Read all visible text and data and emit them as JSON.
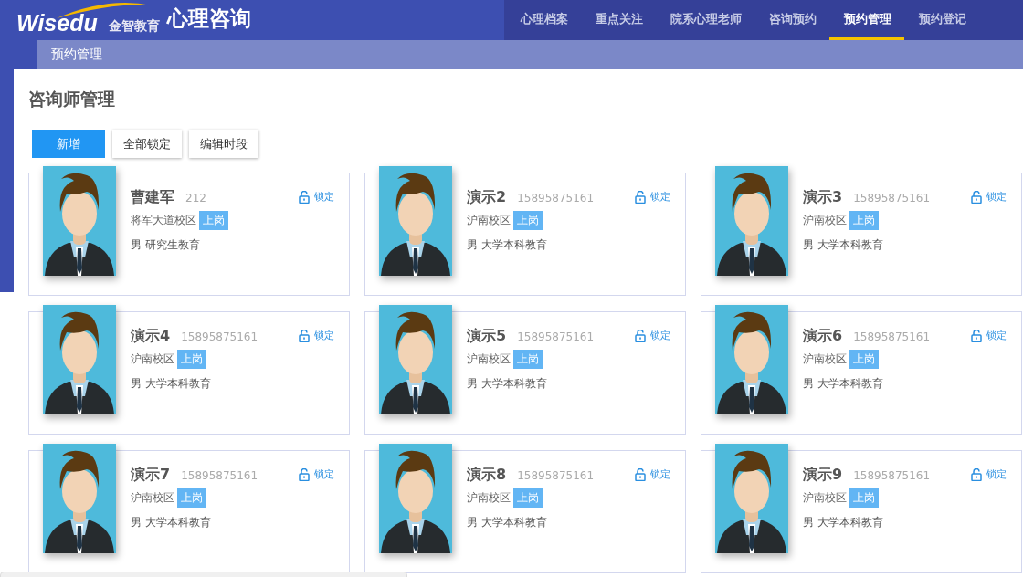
{
  "header": {
    "logo_text": "Wisedu",
    "logo_subtext": "金智教育",
    "app_title": "心理咨询"
  },
  "nav_tabs": [
    {
      "label": "心理档案",
      "selected": false
    },
    {
      "label": "重点关注",
      "selected": false
    },
    {
      "label": "院系心理老师",
      "selected": false
    },
    {
      "label": "咨询预约",
      "selected": false
    },
    {
      "label": "预约管理",
      "selected": true
    },
    {
      "label": "预约登记",
      "selected": false
    }
  ],
  "breadcrumb": "预约管理",
  "page_title": "咨询师管理",
  "toolbar": [
    {
      "label": "新增",
      "kind": "primary"
    },
    {
      "label": "全部锁定",
      "kind": "default"
    },
    {
      "label": "编辑时段",
      "kind": "default"
    }
  ],
  "counselors": [
    {
      "name": "曹建军",
      "phone": "212",
      "campus": "将军大道校区",
      "status": "上岗",
      "details": "男 研究生教育",
      "lock_label": "锁定"
    },
    {
      "name": "演示2",
      "phone": "15895875161",
      "campus": "沪南校区",
      "status": "上岗",
      "details": "男 大学本科教育",
      "lock_label": "锁定"
    },
    {
      "name": "演示3",
      "phone": "15895875161",
      "campus": "沪南校区",
      "status": "上岗",
      "details": "男 大学本科教育",
      "lock_label": "锁定"
    },
    {
      "name": "演示4",
      "phone": "15895875161",
      "campus": "沪南校区",
      "status": "上岗",
      "details": "男 大学本科教育",
      "lock_label": "锁定"
    },
    {
      "name": "演示5",
      "phone": "15895875161",
      "campus": "沪南校区",
      "status": "上岗",
      "details": "男 大学本科教育",
      "lock_label": "锁定"
    },
    {
      "name": "演示6",
      "phone": "15895875161",
      "campus": "沪南校区",
      "status": "上岗",
      "details": "男 大学本科教育",
      "lock_label": "锁定"
    },
    {
      "name": "演示7",
      "phone": "15895875161",
      "campus": "沪南校区",
      "status": "上岗",
      "details": "男 大学本科教育",
      "lock_label": "锁定"
    },
    {
      "name": "演示8",
      "phone": "15895875161",
      "campus": "沪南校区",
      "status": "上岗",
      "details": "男 大学本科教育",
      "lock_label": "锁定"
    },
    {
      "name": "演示9",
      "phone": "15895875161",
      "campus": "沪南校区",
      "status": "上岗",
      "details": "男 大学本科教育",
      "lock_label": "锁定"
    }
  ]
}
